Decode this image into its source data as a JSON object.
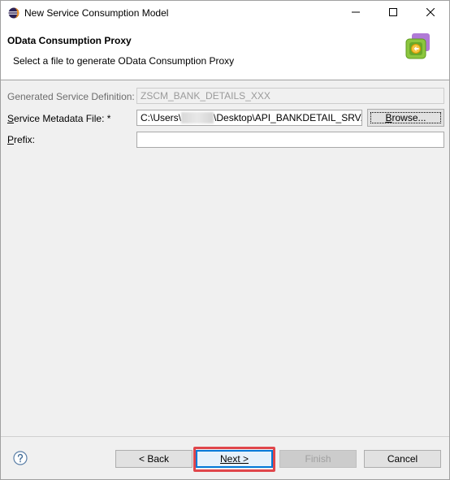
{
  "window": {
    "title": "New Service Consumption Model"
  },
  "header": {
    "title": "OData Consumption Proxy",
    "description": "Select a file to generate OData Consumption Proxy"
  },
  "form": {
    "service_definition": {
      "label": "Generated Service Definition:",
      "value": "ZSCM_BANK_DETAILS_XXX"
    },
    "metadata_file": {
      "label_mnemonic": "S",
      "label_rest": "ervice Metadata File: *",
      "value_prefix": "C:\\Users\\",
      "value_suffix": "\\Desktop\\API_BANKDETAIL_SRV.edmx"
    },
    "browse_button": {
      "label_mnemonic": "B",
      "label_rest": "rowse..."
    },
    "prefix": {
      "label_mnemonic": "P",
      "label_rest": "refix:",
      "value": ""
    }
  },
  "footer": {
    "back_label": "< Back",
    "next_label": "Next >",
    "finish_label": "Finish",
    "cancel_label": "Cancel"
  },
  "icons": {
    "app": "eclipse-icon",
    "wizard": "odata-wizard-icon",
    "help": "help-icon",
    "minimize": "minimize-icon",
    "maximize": "maximize-icon",
    "close": "close-icon"
  },
  "colors": {
    "highlight": "#e0464b",
    "default_button_border": "#0078d7"
  }
}
